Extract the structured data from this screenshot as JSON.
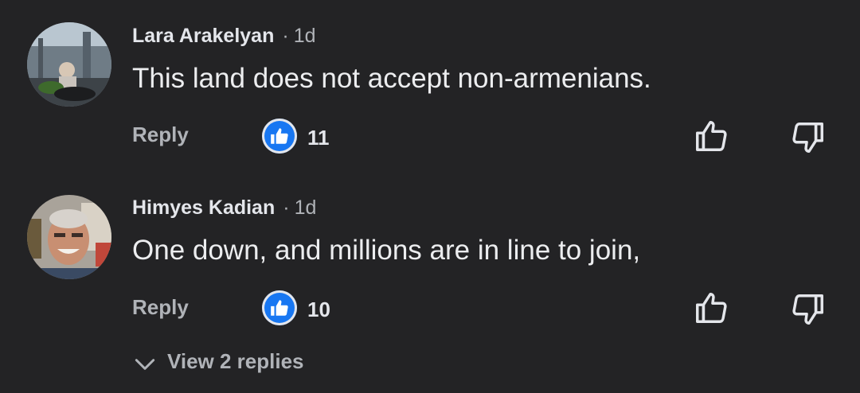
{
  "comments": [
    {
      "author": "Lara Arakelyan",
      "separator": "·",
      "time": "1d",
      "text": "This land does not accept non-armenians.",
      "reply_label": "Reply",
      "like_count": "11",
      "avatar_icon": "avatar-photo"
    },
    {
      "author": "Himyes Kadian",
      "separator": "·",
      "time": "1d",
      "text": "One down, and millions are in line to join,",
      "reply_label": "Reply",
      "like_count": "10",
      "avatar_icon": "avatar-photo"
    }
  ],
  "view_replies": {
    "label": "View 2 replies",
    "icon": "chevron-down-icon"
  },
  "colors": {
    "background": "#232325",
    "like_badge": "#1877f2",
    "secondary_text": "#b0b3b8",
    "primary_text": "#e4e6eb"
  }
}
